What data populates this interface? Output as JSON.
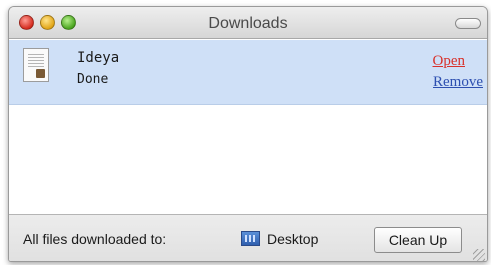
{
  "window": {
    "title": "Downloads"
  },
  "downloads": [
    {
      "name": "Ideya",
      "status": "Done",
      "open_label": "Open",
      "remove_label": "Remove"
    }
  ],
  "footer": {
    "label": "All files downloaded to:",
    "folder": "Desktop",
    "cleanup_label": "Clean Up"
  },
  "colors": {
    "selection": "#cfe0f7",
    "open_link": "#d8312a",
    "remove_link": "#2d4fb0"
  },
  "icons": {
    "file": "document-icon",
    "folder": "desktop-folder-icon"
  }
}
